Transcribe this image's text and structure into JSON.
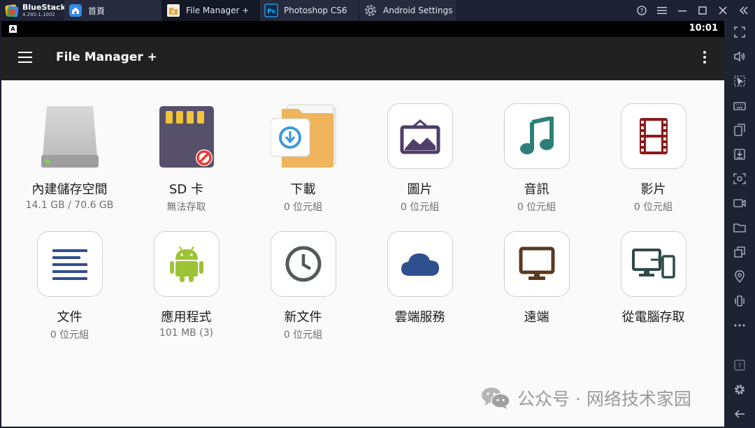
{
  "app": {
    "name": "BlueStacks",
    "version": "4.280.1.1002"
  },
  "tabs": [
    {
      "label": "首頁",
      "icon": "home-icon"
    },
    {
      "label": "File Manager +",
      "icon": "file-manager-icon",
      "active": true
    },
    {
      "label": "Photoshop CS6",
      "icon": "photoshop-icon"
    },
    {
      "label": "Android Settings",
      "icon": "gear-icon"
    }
  ],
  "window_controls": [
    "help-icon",
    "menu-icon",
    "minimize-icon",
    "maximize-icon",
    "close-icon",
    "collapse-sidebar-icon"
  ],
  "status_bar": {
    "indicator": "A",
    "time": "10:01"
  },
  "app_bar": {
    "title": "File Manager +"
  },
  "storage_items": [
    {
      "label": "內建儲存空間",
      "sub": "14.1 GB / 70.6 GB",
      "icon": "internal-storage-icon"
    },
    {
      "label": "SD 卡",
      "sub": "無法存取",
      "icon": "sd-card-icon"
    },
    {
      "label": "下載",
      "sub": "0 位元組",
      "icon": "download-folder-icon"
    },
    {
      "label": "圖片",
      "sub": "0 位元組",
      "icon": "picture-icon"
    },
    {
      "label": "音訊",
      "sub": "0 位元組",
      "icon": "music-icon"
    },
    {
      "label": "影片",
      "sub": "0 位元組",
      "icon": "film-icon"
    },
    {
      "label": "文件",
      "sub": "0 位元組",
      "icon": "document-icon"
    },
    {
      "label": "應用程式",
      "sub": "101 MB (3)",
      "icon": "android-icon"
    },
    {
      "label": "新文件",
      "sub": "0 位元組",
      "icon": "clock-icon"
    },
    {
      "label": "雲端服務",
      "sub": "",
      "icon": "cloud-icon"
    },
    {
      "label": "遠端",
      "sub": "",
      "icon": "monitor-icon"
    },
    {
      "label": "從電腦存取",
      "sub": "",
      "icon": "pc-to-phone-icon"
    }
  ],
  "sidebar_tools": [
    "fullscreen-icon",
    "volume-icon",
    "cursor-icon",
    "keyboard-icon",
    "install-apk-icon",
    "screenshot-save-icon",
    "camera-icon",
    "record-icon",
    "folder-icon",
    "multi-instance-icon",
    "location-icon",
    "shake-icon",
    "more-icon",
    "help-icon",
    "settings-icon",
    "back-icon"
  ],
  "watermark": {
    "text": "公众号 · 网络技术家园"
  },
  "colors": {
    "chrome": "#1e2233",
    "app_bar": "#212121",
    "content_bg": "#fafafa",
    "accent_purple": "#4f3f6b",
    "accent_teal": "#2e7f7a",
    "accent_red": "#8b1a1a",
    "accent_blue": "#2f4f8f",
    "accent_green": "#9cc334"
  }
}
